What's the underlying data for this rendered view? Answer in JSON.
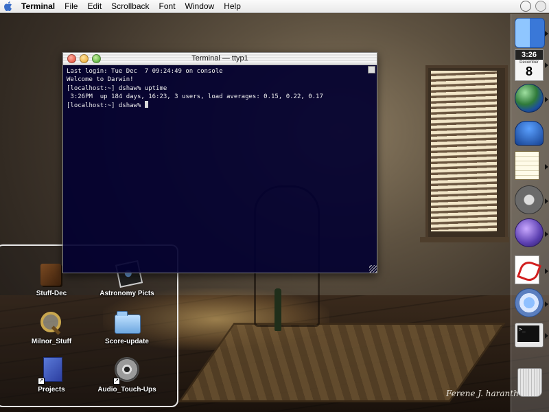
{
  "menubar": {
    "app_name": "Terminal",
    "items": [
      "File",
      "Edit",
      "Scrollback",
      "Font",
      "Window",
      "Help"
    ],
    "apple_icon": "apple-icon",
    "right_icons": [
      "volume-icon",
      "eject-icon"
    ]
  },
  "terminal": {
    "title": "Terminal — ttyp1",
    "lines": [
      "Last login: Tue Dec  7 09:24:49 on console",
      "Welcome to Darwin!",
      "[localhost:~] dshaw% uptime",
      " 3:26PM  up 184 days, 16:23, 3 users, load averages: 0.15, 0.22, 0.17",
      "[localhost:~] dshaw% "
    ],
    "background_color": "#020030"
  },
  "desktop": {
    "icons": [
      {
        "label": "Stuff-Dec",
        "icon": "book-icon"
      },
      {
        "label": "Astronomy Picts",
        "icon": "picture-icon"
      },
      {
        "label": "Milnor_Stuff",
        "icon": "magnifier-icon"
      },
      {
        "label": "Score-update",
        "icon": "folder-icon"
      },
      {
        "label": "Projects",
        "icon": "document-icon"
      },
      {
        "label": "Audio_Touch-Ups",
        "icon": "cd-icon"
      }
    ],
    "signature": "Ferene J. haranth"
  },
  "dock": {
    "clock": {
      "time": "3:26",
      "month": "December",
      "day": "8"
    },
    "terminal_prompt": ">_",
    "items": [
      "finder-icon",
      "clock-icon",
      "globe-icon",
      "mail-icon",
      "notepad-icon",
      "speaker-icon",
      "mask-icon",
      "pdf-icon",
      "itunes-icon",
      "terminal-icon",
      "trash-icon"
    ]
  }
}
